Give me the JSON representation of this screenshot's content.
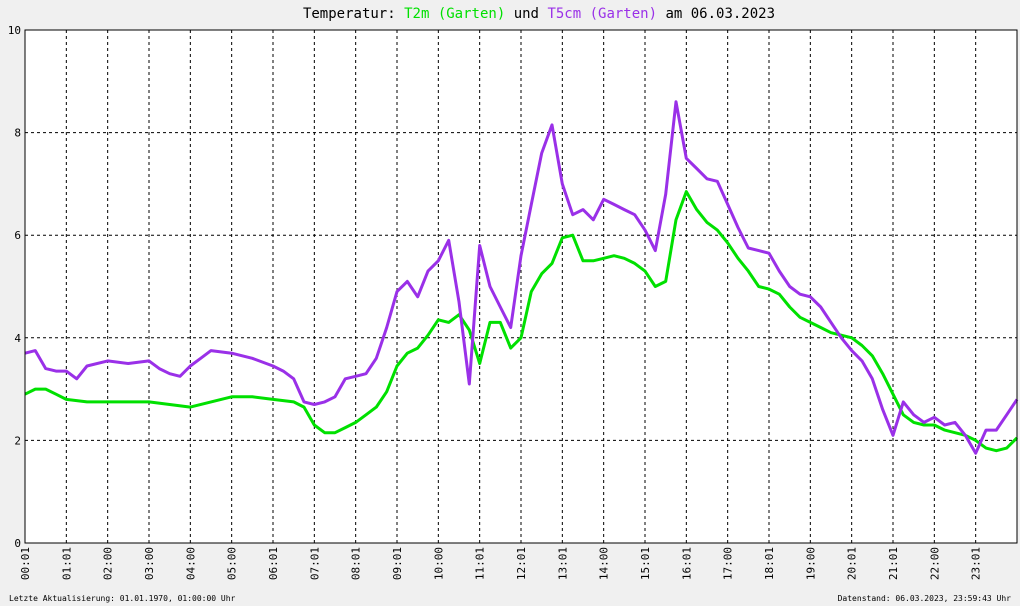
{
  "title": {
    "prefix": "Temperatur:",
    "s1": "T2m (Garten)",
    "mid": "und",
    "s2": "T5cm (Garten)",
    "suffix": "am 06.03.2023"
  },
  "footer": {
    "left": "Letzte Aktualisierung: 01.01.1970, 01:00:00 Uhr",
    "right": "Datenstand: 06.03.2023, 23:59:43 Uhr"
  },
  "colors": {
    "t2m": "#00e000",
    "t5cm": "#9a30e8",
    "grid": "#000000",
    "bg": "#ffffff"
  },
  "chart_data": {
    "type": "line",
    "title": "Temperatur: T2m (Garten) und T5cm (Garten) am 06.03.2023",
    "xlabel": "",
    "ylabel": "",
    "ylim": [
      0,
      10
    ],
    "yticks": [
      "0",
      "2",
      "4",
      "6",
      "8",
      "10"
    ],
    "xlim": [
      0,
      24
    ],
    "xticks": [
      "00:01",
      "01:01",
      "02:00",
      "03:00",
      "04:00",
      "05:00",
      "06:01",
      "07:01",
      "08:01",
      "09:01",
      "10:00",
      "11:01",
      "12:01",
      "13:01",
      "14:00",
      "15:01",
      "16:01",
      "17:00",
      "18:01",
      "19:00",
      "20:01",
      "21:01",
      "22:00",
      "23:01"
    ],
    "grid": true,
    "series": [
      {
        "name": "T2m (Garten)",
        "color": "#00e000",
        "x": [
          0,
          0.25,
          0.5,
          0.75,
          1,
          1.5,
          2,
          2.5,
          3,
          3.5,
          4,
          4.5,
          5,
          5.5,
          6,
          6.5,
          6.75,
          7,
          7.25,
          7.5,
          7.75,
          8,
          8.25,
          8.5,
          8.75,
          9,
          9.25,
          9.5,
          9.75,
          10,
          10.25,
          10.5,
          10.75,
          11,
          11.25,
          11.5,
          11.75,
          12,
          12.25,
          12.5,
          12.75,
          13,
          13.25,
          13.5,
          13.75,
          14,
          14.25,
          14.5,
          14.75,
          15,
          15.25,
          15.5,
          15.75,
          16,
          16.25,
          16.5,
          16.75,
          17,
          17.25,
          17.5,
          17.75,
          18,
          18.25,
          18.5,
          18.75,
          19,
          19.25,
          19.5,
          19.75,
          20,
          20.25,
          20.5,
          20.75,
          21,
          21.25,
          21.5,
          21.75,
          22,
          22.25,
          22.5,
          22.75,
          23,
          23.25,
          23.5,
          23.75,
          24
        ],
        "y": [
          2.9,
          3.0,
          3.0,
          2.9,
          2.8,
          2.75,
          2.75,
          2.75,
          2.75,
          2.7,
          2.65,
          2.75,
          2.85,
          2.85,
          2.8,
          2.75,
          2.65,
          2.3,
          2.15,
          2.15,
          2.25,
          2.35,
          2.5,
          2.65,
          2.95,
          3.45,
          3.7,
          3.8,
          4.05,
          4.35,
          4.3,
          4.45,
          4.15,
          3.5,
          4.3,
          4.3,
          3.8,
          4.0,
          4.9,
          5.25,
          5.45,
          5.95,
          6.0,
          5.5,
          5.5,
          5.55,
          5.6,
          5.55,
          5.45,
          5.3,
          5.0,
          5.1,
          6.3,
          6.85,
          6.5,
          6.25,
          6.1,
          5.85,
          5.55,
          5.3,
          5.0,
          4.95,
          4.85,
          4.6,
          4.4,
          4.3,
          4.2,
          4.1,
          4.05,
          4.0,
          3.85,
          3.65,
          3.3,
          2.9,
          2.5,
          2.35,
          2.3,
          2.3,
          2.2,
          2.15,
          2.1,
          2.0,
          1.85,
          1.8,
          1.85,
          2.05
        ]
      },
      {
        "name": "T5cm (Garten)",
        "color": "#9a30e8",
        "x": [
          0,
          0.25,
          0.5,
          0.75,
          1,
          1.25,
          1.5,
          2,
          2.5,
          3,
          3.25,
          3.5,
          3.75,
          4,
          4.25,
          4.5,
          5,
          5.5,
          6,
          6.25,
          6.5,
          6.75,
          7,
          7.25,
          7.5,
          7.75,
          8,
          8.25,
          8.5,
          8.75,
          9,
          9.25,
          9.5,
          9.75,
          10,
          10.25,
          10.5,
          10.75,
          11,
          11.25,
          11.5,
          11.75,
          12,
          12.25,
          12.5,
          12.75,
          13,
          13.25,
          13.5,
          13.75,
          14,
          14.25,
          14.5,
          14.75,
          15,
          15.25,
          15.5,
          15.75,
          16,
          16.25,
          16.5,
          16.75,
          17,
          17.25,
          17.5,
          17.75,
          18,
          18.25,
          18.5,
          18.75,
          19,
          19.25,
          19.5,
          19.75,
          20,
          20.25,
          20.5,
          20.75,
          21,
          21.25,
          21.5,
          21.75,
          22,
          22.25,
          22.5,
          22.75,
          23,
          23.25,
          23.5,
          23.75,
          24
        ],
        "y": [
          3.7,
          3.75,
          3.4,
          3.35,
          3.35,
          3.2,
          3.45,
          3.55,
          3.5,
          3.55,
          3.4,
          3.3,
          3.25,
          3.45,
          3.6,
          3.75,
          3.7,
          3.6,
          3.45,
          3.35,
          3.2,
          2.75,
          2.7,
          2.75,
          2.85,
          3.2,
          3.25,
          3.3,
          3.6,
          4.2,
          4.9,
          5.1,
          4.8,
          5.3,
          5.5,
          5.9,
          4.7,
          3.1,
          5.8,
          5.0,
          4.6,
          4.2,
          5.6,
          6.6,
          7.6,
          8.15,
          7.0,
          6.4,
          6.5,
          6.3,
          6.7,
          6.6,
          6.5,
          6.4,
          6.1,
          5.7,
          6.8,
          8.6,
          7.5,
          7.3,
          7.1,
          7.05,
          6.6,
          6.15,
          5.75,
          5.7,
          5.65,
          5.3,
          5.0,
          4.85,
          4.8,
          4.6,
          4.3,
          4.0,
          3.75,
          3.55,
          3.2,
          2.6,
          2.1,
          2.75,
          2.5,
          2.35,
          2.45,
          2.3,
          2.35,
          2.1,
          1.75,
          2.2,
          2.2,
          2.5,
          2.8
        ]
      }
    ]
  }
}
